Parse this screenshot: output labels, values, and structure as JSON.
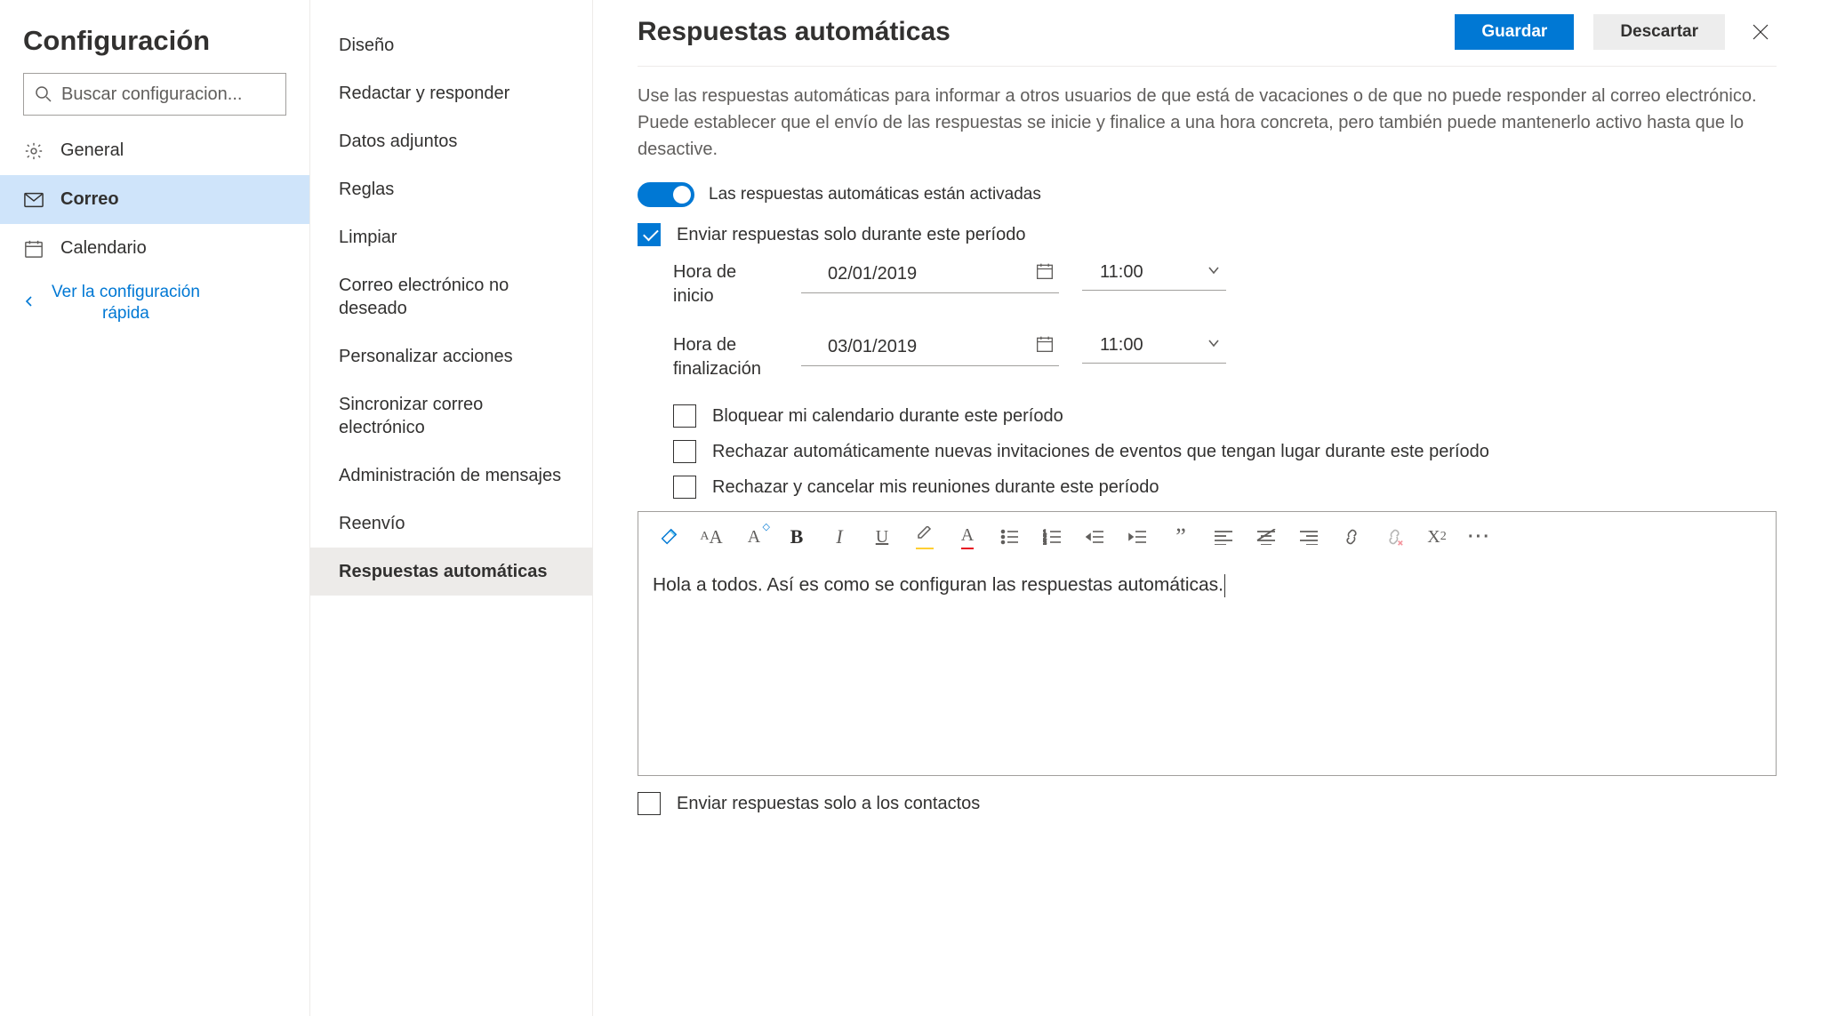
{
  "left": {
    "title": "Configuración",
    "search_placeholder": "Buscar configuracion...",
    "nav": [
      {
        "label": "General"
      },
      {
        "label": "Correo"
      },
      {
        "label": "Calendario"
      }
    ],
    "quick_link": "Ver la configuración\nrápida"
  },
  "mid": {
    "items": [
      "Diseño",
      "Redactar y responder",
      "Datos adjuntos",
      "Reglas",
      "Limpiar",
      "Correo electrónico no deseado",
      "Personalizar acciones",
      "Sincronizar correo electrónico",
      "Administración de mensajes",
      "Reenvío",
      "Respuestas automáticas"
    ]
  },
  "right": {
    "title": "Respuestas automáticas",
    "save": "Guardar",
    "discard": "Descartar",
    "description": "Use las respuestas automáticas para informar a otros usuarios de que está de vacaciones o de que no puede responder al correo electrónico. Puede establecer que el envío de las respuestas se inicie y finalice a una hora concreta, pero también puede mantenerlo activo hasta que lo desactive.",
    "toggle_label": "Las respuestas automáticas están activadas",
    "period_label": "Enviar respuestas solo durante este período",
    "start_label": "Hora de inicio",
    "start_date": "02/01/2019",
    "start_time": "11:00",
    "end_label": "Hora de finalización",
    "end_date": "03/01/2019",
    "end_time": "11:00",
    "opt_block": "Bloquear mi calendario durante este período",
    "opt_decline": "Rechazar automáticamente nuevas invitaciones de eventos que tengan lugar durante este período",
    "opt_cancel": "Rechazar y cancelar mis reuniones durante este período",
    "editor_text": "Hola a todos. Así es como se configuran las respuestas automáticas.",
    "contacts_only": "Enviar respuestas solo a los contactos"
  }
}
